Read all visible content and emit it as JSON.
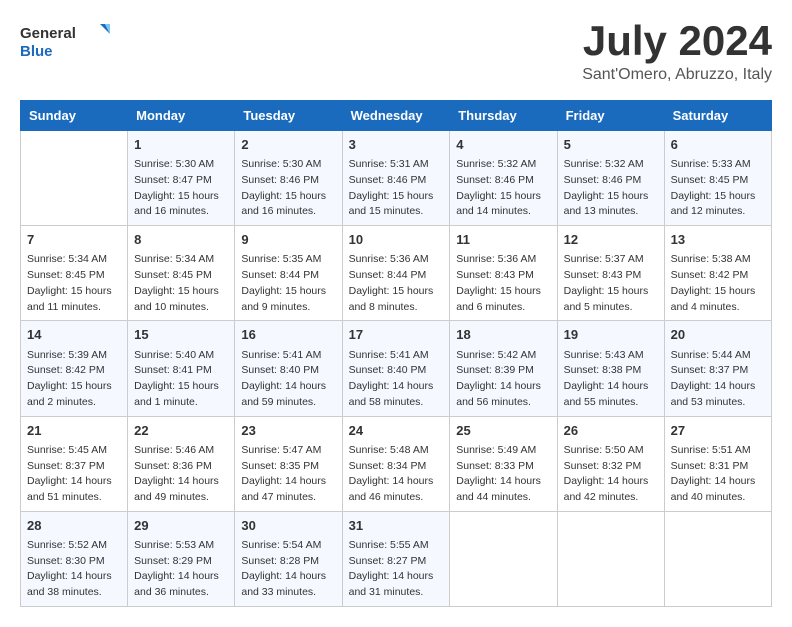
{
  "logo": {
    "text_general": "General",
    "text_blue": "Blue"
  },
  "header": {
    "month": "July 2024",
    "location": "Sant'Omero, Abruzzo, Italy"
  },
  "columns": [
    "Sunday",
    "Monday",
    "Tuesday",
    "Wednesday",
    "Thursday",
    "Friday",
    "Saturday"
  ],
  "weeks": [
    [
      {
        "day": "",
        "sunrise": "",
        "sunset": "",
        "daylight": ""
      },
      {
        "day": "1",
        "sunrise": "Sunrise: 5:30 AM",
        "sunset": "Sunset: 8:47 PM",
        "daylight": "Daylight: 15 hours and 16 minutes."
      },
      {
        "day": "2",
        "sunrise": "Sunrise: 5:30 AM",
        "sunset": "Sunset: 8:46 PM",
        "daylight": "Daylight: 15 hours and 16 minutes."
      },
      {
        "day": "3",
        "sunrise": "Sunrise: 5:31 AM",
        "sunset": "Sunset: 8:46 PM",
        "daylight": "Daylight: 15 hours and 15 minutes."
      },
      {
        "day": "4",
        "sunrise": "Sunrise: 5:32 AM",
        "sunset": "Sunset: 8:46 PM",
        "daylight": "Daylight: 15 hours and 14 minutes."
      },
      {
        "day": "5",
        "sunrise": "Sunrise: 5:32 AM",
        "sunset": "Sunset: 8:46 PM",
        "daylight": "Daylight: 15 hours and 13 minutes."
      },
      {
        "day": "6",
        "sunrise": "Sunrise: 5:33 AM",
        "sunset": "Sunset: 8:45 PM",
        "daylight": "Daylight: 15 hours and 12 minutes."
      }
    ],
    [
      {
        "day": "7",
        "sunrise": "Sunrise: 5:34 AM",
        "sunset": "Sunset: 8:45 PM",
        "daylight": "Daylight: 15 hours and 11 minutes."
      },
      {
        "day": "8",
        "sunrise": "Sunrise: 5:34 AM",
        "sunset": "Sunset: 8:45 PM",
        "daylight": "Daylight: 15 hours and 10 minutes."
      },
      {
        "day": "9",
        "sunrise": "Sunrise: 5:35 AM",
        "sunset": "Sunset: 8:44 PM",
        "daylight": "Daylight: 15 hours and 9 minutes."
      },
      {
        "day": "10",
        "sunrise": "Sunrise: 5:36 AM",
        "sunset": "Sunset: 8:44 PM",
        "daylight": "Daylight: 15 hours and 8 minutes."
      },
      {
        "day": "11",
        "sunrise": "Sunrise: 5:36 AM",
        "sunset": "Sunset: 8:43 PM",
        "daylight": "Daylight: 15 hours and 6 minutes."
      },
      {
        "day": "12",
        "sunrise": "Sunrise: 5:37 AM",
        "sunset": "Sunset: 8:43 PM",
        "daylight": "Daylight: 15 hours and 5 minutes."
      },
      {
        "day": "13",
        "sunrise": "Sunrise: 5:38 AM",
        "sunset": "Sunset: 8:42 PM",
        "daylight": "Daylight: 15 hours and 4 minutes."
      }
    ],
    [
      {
        "day": "14",
        "sunrise": "Sunrise: 5:39 AM",
        "sunset": "Sunset: 8:42 PM",
        "daylight": "Daylight: 15 hours and 2 minutes."
      },
      {
        "day": "15",
        "sunrise": "Sunrise: 5:40 AM",
        "sunset": "Sunset: 8:41 PM",
        "daylight": "Daylight: 15 hours and 1 minute."
      },
      {
        "day": "16",
        "sunrise": "Sunrise: 5:41 AM",
        "sunset": "Sunset: 8:40 PM",
        "daylight": "Daylight: 14 hours and 59 minutes."
      },
      {
        "day": "17",
        "sunrise": "Sunrise: 5:41 AM",
        "sunset": "Sunset: 8:40 PM",
        "daylight": "Daylight: 14 hours and 58 minutes."
      },
      {
        "day": "18",
        "sunrise": "Sunrise: 5:42 AM",
        "sunset": "Sunset: 8:39 PM",
        "daylight": "Daylight: 14 hours and 56 minutes."
      },
      {
        "day": "19",
        "sunrise": "Sunrise: 5:43 AM",
        "sunset": "Sunset: 8:38 PM",
        "daylight": "Daylight: 14 hours and 55 minutes."
      },
      {
        "day": "20",
        "sunrise": "Sunrise: 5:44 AM",
        "sunset": "Sunset: 8:37 PM",
        "daylight": "Daylight: 14 hours and 53 minutes."
      }
    ],
    [
      {
        "day": "21",
        "sunrise": "Sunrise: 5:45 AM",
        "sunset": "Sunset: 8:37 PM",
        "daylight": "Daylight: 14 hours and 51 minutes."
      },
      {
        "day": "22",
        "sunrise": "Sunrise: 5:46 AM",
        "sunset": "Sunset: 8:36 PM",
        "daylight": "Daylight: 14 hours and 49 minutes."
      },
      {
        "day": "23",
        "sunrise": "Sunrise: 5:47 AM",
        "sunset": "Sunset: 8:35 PM",
        "daylight": "Daylight: 14 hours and 47 minutes."
      },
      {
        "day": "24",
        "sunrise": "Sunrise: 5:48 AM",
        "sunset": "Sunset: 8:34 PM",
        "daylight": "Daylight: 14 hours and 46 minutes."
      },
      {
        "day": "25",
        "sunrise": "Sunrise: 5:49 AM",
        "sunset": "Sunset: 8:33 PM",
        "daylight": "Daylight: 14 hours and 44 minutes."
      },
      {
        "day": "26",
        "sunrise": "Sunrise: 5:50 AM",
        "sunset": "Sunset: 8:32 PM",
        "daylight": "Daylight: 14 hours and 42 minutes."
      },
      {
        "day": "27",
        "sunrise": "Sunrise: 5:51 AM",
        "sunset": "Sunset: 8:31 PM",
        "daylight": "Daylight: 14 hours and 40 minutes."
      }
    ],
    [
      {
        "day": "28",
        "sunrise": "Sunrise: 5:52 AM",
        "sunset": "Sunset: 8:30 PM",
        "daylight": "Daylight: 14 hours and 38 minutes."
      },
      {
        "day": "29",
        "sunrise": "Sunrise: 5:53 AM",
        "sunset": "Sunset: 8:29 PM",
        "daylight": "Daylight: 14 hours and 36 minutes."
      },
      {
        "day": "30",
        "sunrise": "Sunrise: 5:54 AM",
        "sunset": "Sunset: 8:28 PM",
        "daylight": "Daylight: 14 hours and 33 minutes."
      },
      {
        "day": "31",
        "sunrise": "Sunrise: 5:55 AM",
        "sunset": "Sunset: 8:27 PM",
        "daylight": "Daylight: 14 hours and 31 minutes."
      },
      {
        "day": "",
        "sunrise": "",
        "sunset": "",
        "daylight": ""
      },
      {
        "day": "",
        "sunrise": "",
        "sunset": "",
        "daylight": ""
      },
      {
        "day": "",
        "sunrise": "",
        "sunset": "",
        "daylight": ""
      }
    ]
  ]
}
